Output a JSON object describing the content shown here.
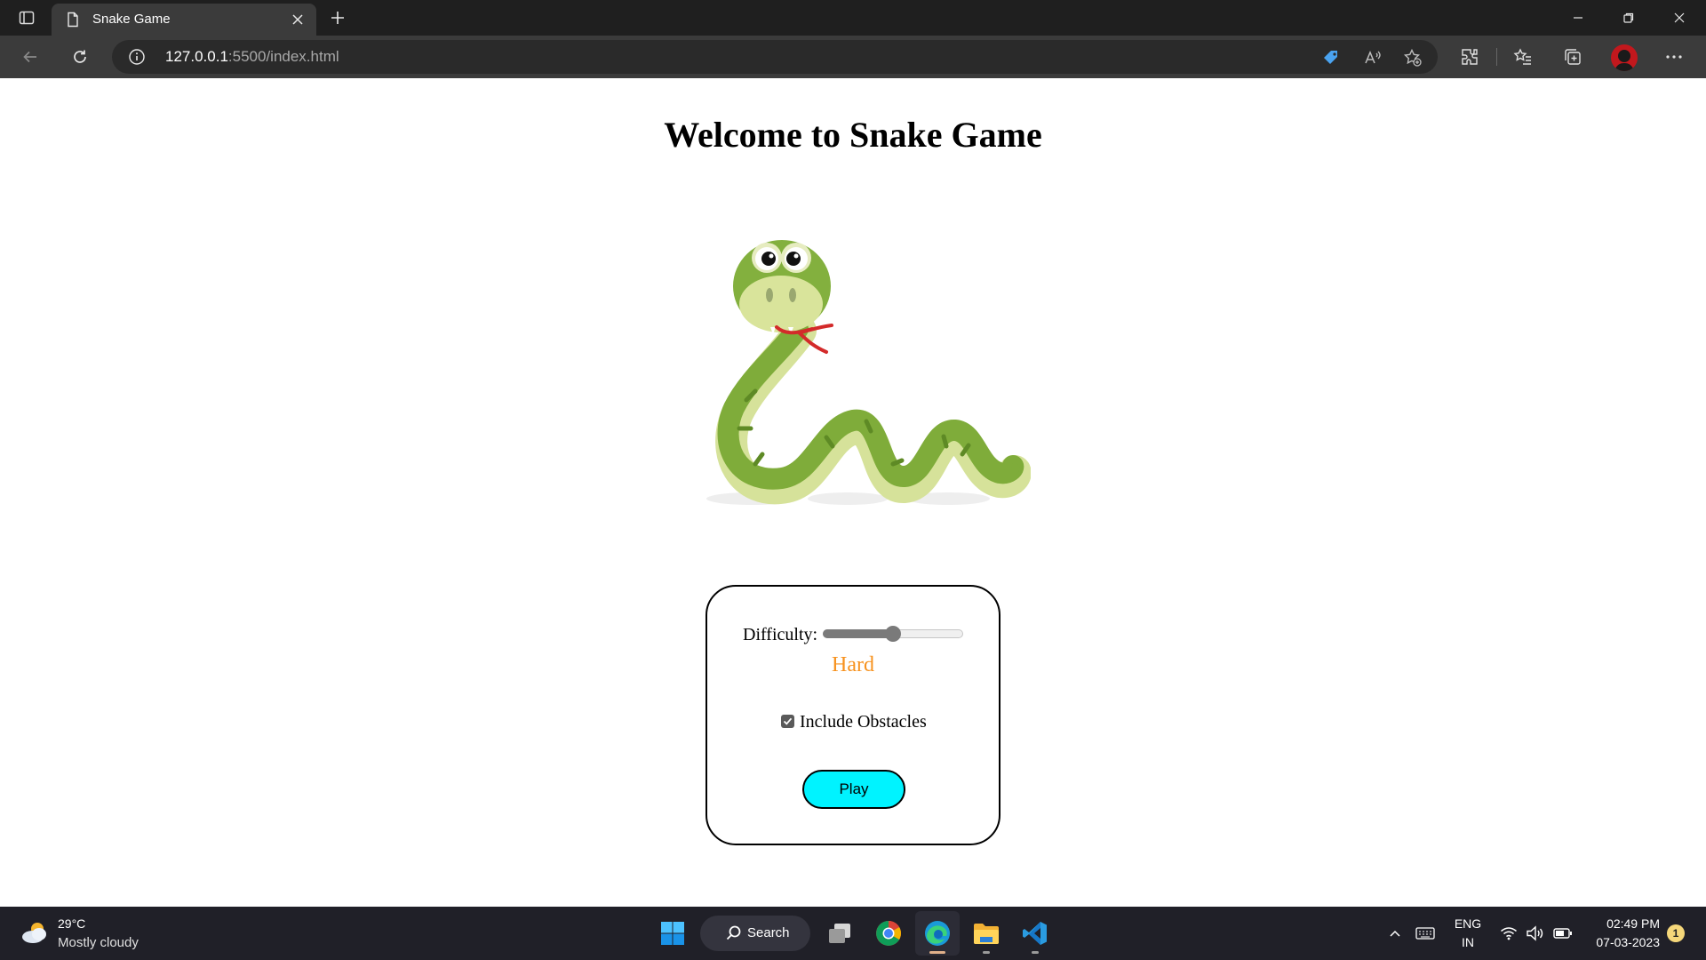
{
  "browser": {
    "tab_title": "Snake Game",
    "url_host": "127.0.0.1",
    "url_rest": ":5500/index.html"
  },
  "page": {
    "title": "Welcome to Snake Game"
  },
  "settings": {
    "difficulty_label": "Difficulty:",
    "difficulty_value": "Hard",
    "difficulty_value_color": "#f7921e",
    "difficulty_level": 0.5,
    "obstacles_label": "Include Obstacles",
    "obstacles_checked": true,
    "play_label": "Play",
    "play_button_color": "#00f3ff"
  },
  "taskbar": {
    "weather_temp": "29°C",
    "weather_desc": "Mostly cloudy",
    "search_label": "Search",
    "lang_top": "ENG",
    "lang_bottom": "IN",
    "time": "02:49 PM",
    "date": "07-03-2023",
    "notification_count": "1"
  }
}
